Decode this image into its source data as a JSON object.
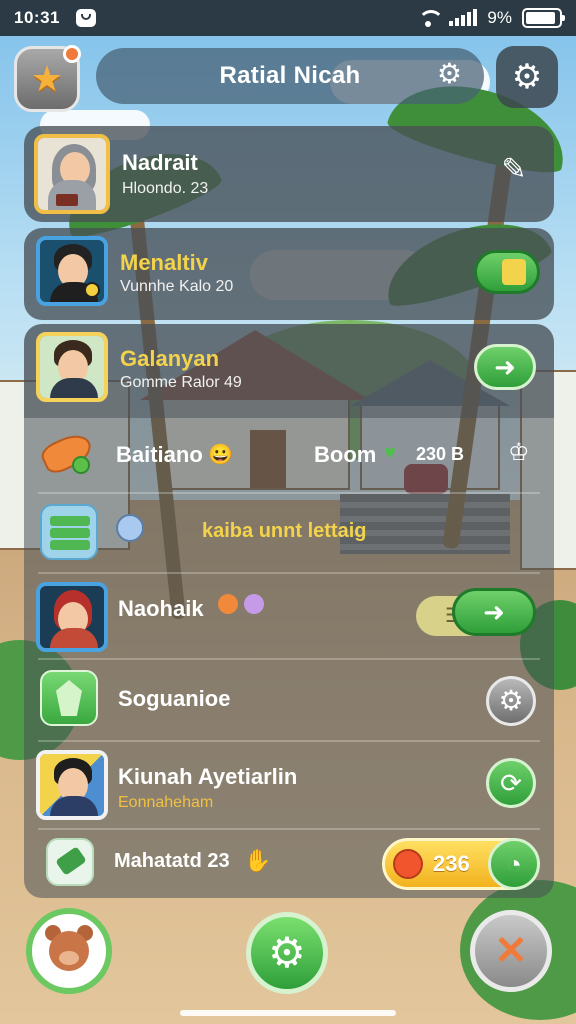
{
  "status_bar": {
    "time": "10:31",
    "battery": "9%"
  },
  "header": {
    "title": "Ratial Nicah"
  },
  "rows": [
    {
      "name": "Nadrait",
      "sub": "Hloondo. 23"
    },
    {
      "name": "Menaltiv",
      "sub": "Vunnhe Kalo 20"
    },
    {
      "name": "Galanyan",
      "sub": "Gomme Ralor 49"
    },
    {
      "name": "Baitiano",
      "emoji": "😀",
      "extra_label": "Boom",
      "extra_value": "230 B"
    },
    {
      "name": "",
      "banner_text": "kaiba unnt lettaig"
    },
    {
      "name": "Naohaik"
    },
    {
      "name": "Soguanioe"
    },
    {
      "name": "Kiunah Ayetiarlin",
      "sub": "Eonnaheham"
    },
    {
      "name": "Mahatatd 23",
      "coin_value": "236"
    }
  ],
  "icons": {
    "header_star": "star-icon",
    "header_gear": "gear-icon",
    "settings": "gear-icon",
    "edit": "edit-pencil-icon",
    "nav_left": "bear-avatar-icon",
    "nav_center": "gear-icon",
    "nav_right": "close-icon"
  },
  "colors": {
    "accent_green": "#2f9f3a",
    "accent_gold": "#f3d34b",
    "panel": "#485056"
  }
}
